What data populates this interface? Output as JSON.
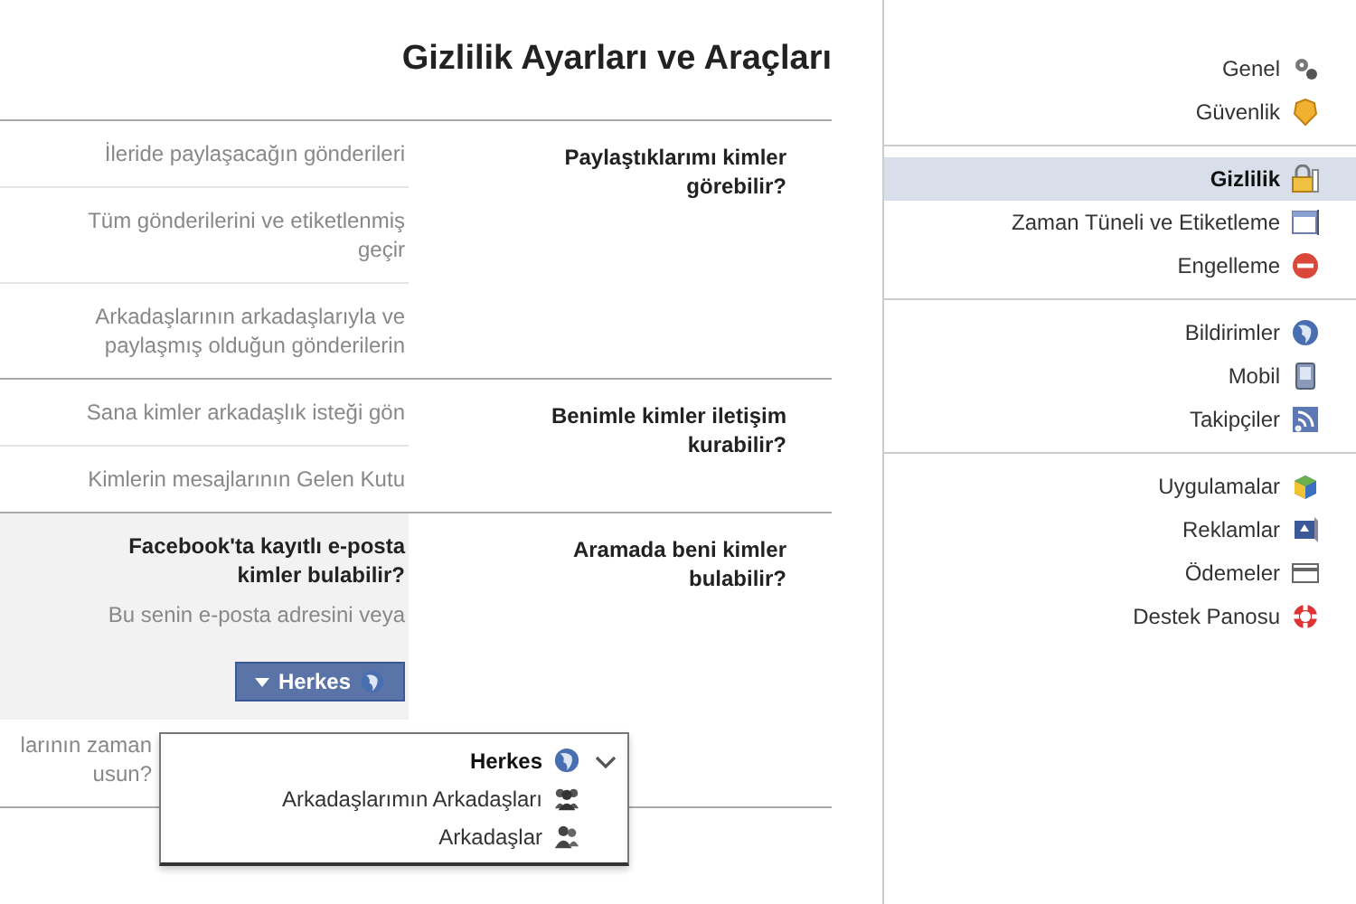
{
  "title": "Gizlilik Ayarları ve Araçları",
  "sections": [
    {
      "label": "Paylaştıklarımı kimler görebilir?",
      "rows": [
        {
          "kind": "text",
          "lines": [
            "İleride paylaşacağın gönderileri"
          ]
        },
        {
          "kind": "text",
          "lines": [
            "Tüm gönderilerini ve etiketlenmiş",
            "geçir"
          ]
        },
        {
          "kind": "text",
          "lines": [
            "Arkadaşlarının arkadaşlarıyla ve",
            "paylaşmış olduğun gönderilerin"
          ]
        }
      ]
    },
    {
      "label": "Benimle kimler iletişim kurabilir?",
      "rows": [
        {
          "kind": "text",
          "lines": [
            "Sana kimler arkadaşlık isteği gön"
          ]
        },
        {
          "kind": "text",
          "lines": [
            "Kimlerin mesajlarının Gelen Kutu"
          ]
        }
      ]
    },
    {
      "label": "Aramada beni kimler bulabilir?",
      "rows": [
        {
          "kind": "editor",
          "title": [
            "Facebook'ta kayıtlı e-posta",
            "kimler bulabilir?"
          ],
          "description": "Bu senin e-posta adresini veya",
          "button": "Herkes",
          "menu": [
            {
              "label": "Herkes",
              "selected": true
            },
            {
              "label": "Arkadaşlarımın Arkadaşları",
              "selected": false
            },
            {
              "label": "Arkadaşlar",
              "selected": false
            }
          ]
        },
        {
          "kind": "partial",
          "lines": [
            "larının zaman",
            "usun?"
          ]
        }
      ]
    }
  ],
  "sidebar": [
    [
      {
        "label": "Genel",
        "selected": false
      },
      {
        "label": "Güvenlik",
        "selected": false
      }
    ],
    [
      {
        "label": "Gizlilik",
        "selected": true
      },
      {
        "label": "Zaman Tüneli ve Etiketleme",
        "selected": false
      },
      {
        "label": "Engelleme",
        "selected": false
      }
    ],
    [
      {
        "label": "Bildirimler",
        "selected": false
      },
      {
        "label": "Mobil",
        "selected": false
      },
      {
        "label": "Takipçiler",
        "selected": false
      }
    ],
    [
      {
        "label": "Uygulamalar",
        "selected": false
      },
      {
        "label": "Reklamlar",
        "selected": false
      },
      {
        "label": "Ödemeler",
        "selected": false
      },
      {
        "label": "Destek Panosu",
        "selected": false
      }
    ]
  ]
}
